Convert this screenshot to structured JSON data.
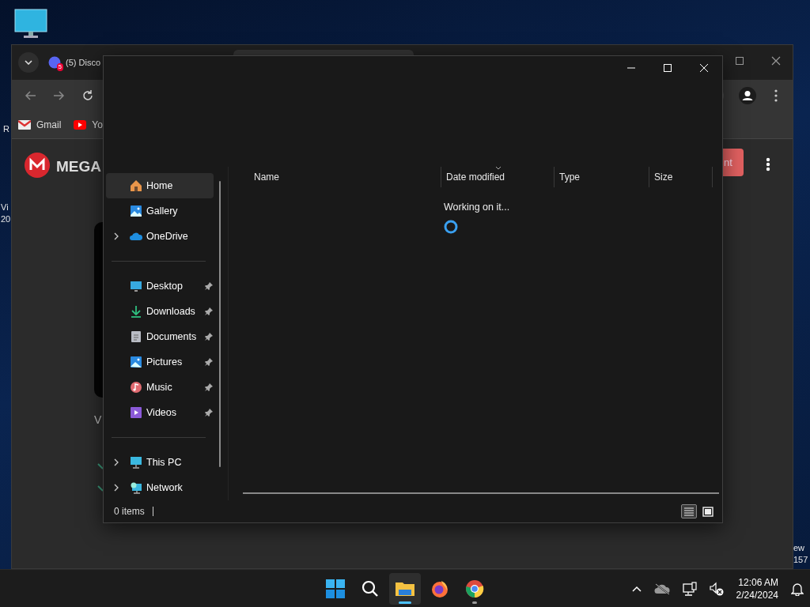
{
  "desktop": {
    "left_edge_texts": [
      "R",
      "Vi",
      "20"
    ],
    "right_edge_texts": [
      "ew",
      "157"
    ]
  },
  "browser": {
    "tabs": [
      {
        "title": "(5) Disco",
        "badge": "5"
      }
    ],
    "bookmarks": [
      {
        "label": "Gmail",
        "kind": "gmail"
      },
      {
        "label": "Yo",
        "kind": "youtube"
      }
    ],
    "logo_text": "MEGA",
    "action_button": "nt",
    "side_text": "V"
  },
  "explorer": {
    "nav_groups": [
      [
        {
          "label": "Home",
          "kind": "home",
          "selected": true,
          "expandable": false,
          "pinned": false
        },
        {
          "label": "Gallery",
          "kind": "gallery",
          "selected": false,
          "expandable": false,
          "pinned": false
        },
        {
          "label": "OneDrive",
          "kind": "cloud",
          "selected": false,
          "expandable": true,
          "pinned": false
        }
      ],
      [
        {
          "label": "Desktop",
          "kind": "desktop",
          "selected": false,
          "expandable": false,
          "pinned": true
        },
        {
          "label": "Downloads",
          "kind": "download",
          "selected": false,
          "expandable": false,
          "pinned": true
        },
        {
          "label": "Documents",
          "kind": "document",
          "selected": false,
          "expandable": false,
          "pinned": true
        },
        {
          "label": "Pictures",
          "kind": "pictures",
          "selected": false,
          "expandable": false,
          "pinned": true
        },
        {
          "label": "Music",
          "kind": "music",
          "selected": false,
          "expandable": false,
          "pinned": true
        },
        {
          "label": "Videos",
          "kind": "videos",
          "selected": false,
          "expandable": false,
          "pinned": true
        }
      ],
      [
        {
          "label": "This PC",
          "kind": "pc",
          "selected": false,
          "expandable": true,
          "pinned": false
        },
        {
          "label": "Network",
          "kind": "network",
          "selected": false,
          "expandable": true,
          "pinned": false
        }
      ]
    ],
    "columns": [
      {
        "label": "Name",
        "sorted": false
      },
      {
        "label": "Date modified",
        "sorted": true
      },
      {
        "label": "Type",
        "sorted": false
      },
      {
        "label": "Size",
        "sorted": false
      }
    ],
    "loading_text": "Working on it...",
    "item_count": "0 items",
    "views": [
      {
        "kind": "details",
        "selected": true
      },
      {
        "kind": "tiles",
        "selected": false
      }
    ]
  },
  "taskbar": {
    "apps": [
      {
        "kind": "start",
        "selected": false,
        "running": false
      },
      {
        "kind": "search",
        "selected": false,
        "running": false
      },
      {
        "kind": "explorer",
        "selected": true,
        "running": true
      },
      {
        "kind": "firefox",
        "selected": false,
        "running": false
      },
      {
        "kind": "chrome",
        "selected": false,
        "running": true
      }
    ],
    "time": "12:06 AM",
    "date": "2/24/2024"
  }
}
